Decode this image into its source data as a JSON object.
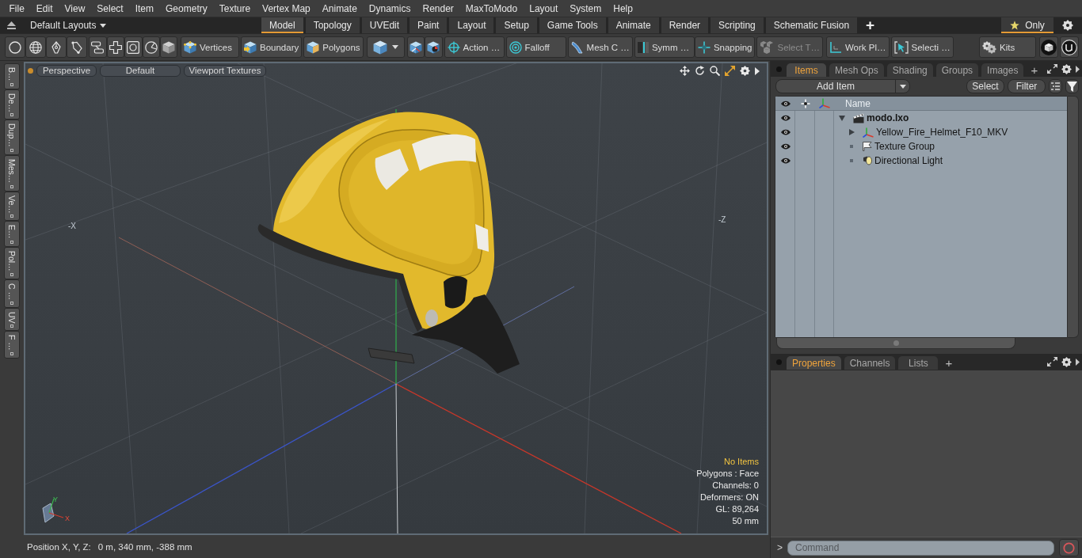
{
  "menu_bar": [
    "File",
    "Edit",
    "View",
    "Select",
    "Item",
    "Geometry",
    "Texture",
    "Vertex Map",
    "Animate",
    "Dynamics",
    "Render",
    "MaxToModo",
    "Layout",
    "System",
    "Help"
  ],
  "layout_bar": {
    "layouts_menu": "Default Layouts",
    "tabs": [
      {
        "label": "Model",
        "selected": true
      },
      {
        "label": "Topology",
        "selected": false
      },
      {
        "label": "UVEdit",
        "selected": false
      },
      {
        "label": "Paint",
        "selected": false
      },
      {
        "label": "Layout",
        "selected": false
      },
      {
        "label": "Setup",
        "selected": false
      },
      {
        "label": "Game Tools",
        "selected": false
      },
      {
        "label": "Animate",
        "selected": false
      },
      {
        "label": "Render",
        "selected": false
      },
      {
        "label": "Scripting",
        "selected": false
      },
      {
        "label": "Schematic Fusion",
        "selected": false
      }
    ],
    "add_tab": "+",
    "favorites": {
      "label": "Only",
      "selected": true
    }
  },
  "toolbar": {
    "selection_modes": [
      "Vertices",
      "Boundary",
      "Polygons"
    ],
    "tools": [
      {
        "label": "Action …",
        "disabled": false
      },
      {
        "label": "Falloff",
        "disabled": false
      },
      {
        "label": "Mesh C …",
        "disabled": false
      },
      {
        "label": "Symm …",
        "disabled": false
      },
      {
        "label": "Snapping",
        "disabled": false
      },
      {
        "label": "Select T…",
        "disabled": true
      },
      {
        "label": "Work Pl…",
        "disabled": false
      },
      {
        "label": "Selecti …",
        "disabled": false
      }
    ],
    "kits": "Kits"
  },
  "side_tabs": [
    "B…",
    "De…",
    "Dup…",
    "Mes…",
    "Ve…",
    "E…",
    "Pol…",
    "C …",
    "UV",
    "F …"
  ],
  "viewport": {
    "view_buttons": [
      "Perspective",
      "Default",
      "Viewport Textures"
    ],
    "grid_labels": [
      "-X",
      "-Z"
    ],
    "gizmo_labels": [
      "Y",
      "X"
    ],
    "info": [
      {
        "text": "No Items",
        "kind": "notice"
      },
      {
        "text": "Polygons : Face",
        "kind": "plain"
      },
      {
        "text": "Channels: 0",
        "kind": "plain"
      },
      {
        "text": "Deformers: ON",
        "kind": "plain"
      },
      {
        "text": "GL: 89,264",
        "kind": "plain"
      },
      {
        "text": "50 mm",
        "kind": "plain"
      }
    ]
  },
  "status_bar": {
    "label": "Position X, Y, Z:",
    "value": "0 m, 340 mm, -388 mm"
  },
  "items_panel": {
    "tabs": [
      {
        "label": "Items",
        "selected": true
      },
      {
        "label": "Mesh Ops",
        "selected": false
      },
      {
        "label": "Shading",
        "selected": false
      },
      {
        "label": "Groups",
        "selected": false
      },
      {
        "label": "Images",
        "selected": false
      }
    ],
    "add_tab": "+",
    "add_item": "Add Item",
    "buttons": [
      "Select",
      "Filter"
    ],
    "name_column": "Name",
    "tree": [
      {
        "label": "modo.lxo",
        "kind": "scene",
        "visible": true,
        "expandable": true,
        "expanded": true,
        "children": [
          {
            "label": "Yellow_Fire_Helmet_F10_MKV",
            "kind": "mesh",
            "visible": true,
            "expandable": true,
            "expanded": false
          },
          {
            "label": "Texture Group",
            "kind": "texture_group",
            "visible": true,
            "expandable": false,
            "expanded": false
          },
          {
            "label": "Directional Light",
            "kind": "light",
            "visible": true,
            "expandable": false,
            "expanded": false
          }
        ]
      }
    ]
  },
  "properties_panel": {
    "tabs": [
      {
        "label": "Properties",
        "selected": true
      },
      {
        "label": "Channels",
        "selected": false
      },
      {
        "label": "Lists",
        "selected": false
      }
    ],
    "add_tab": "+"
  },
  "command_bar": {
    "prompt": ">",
    "placeholder": "Command"
  }
}
